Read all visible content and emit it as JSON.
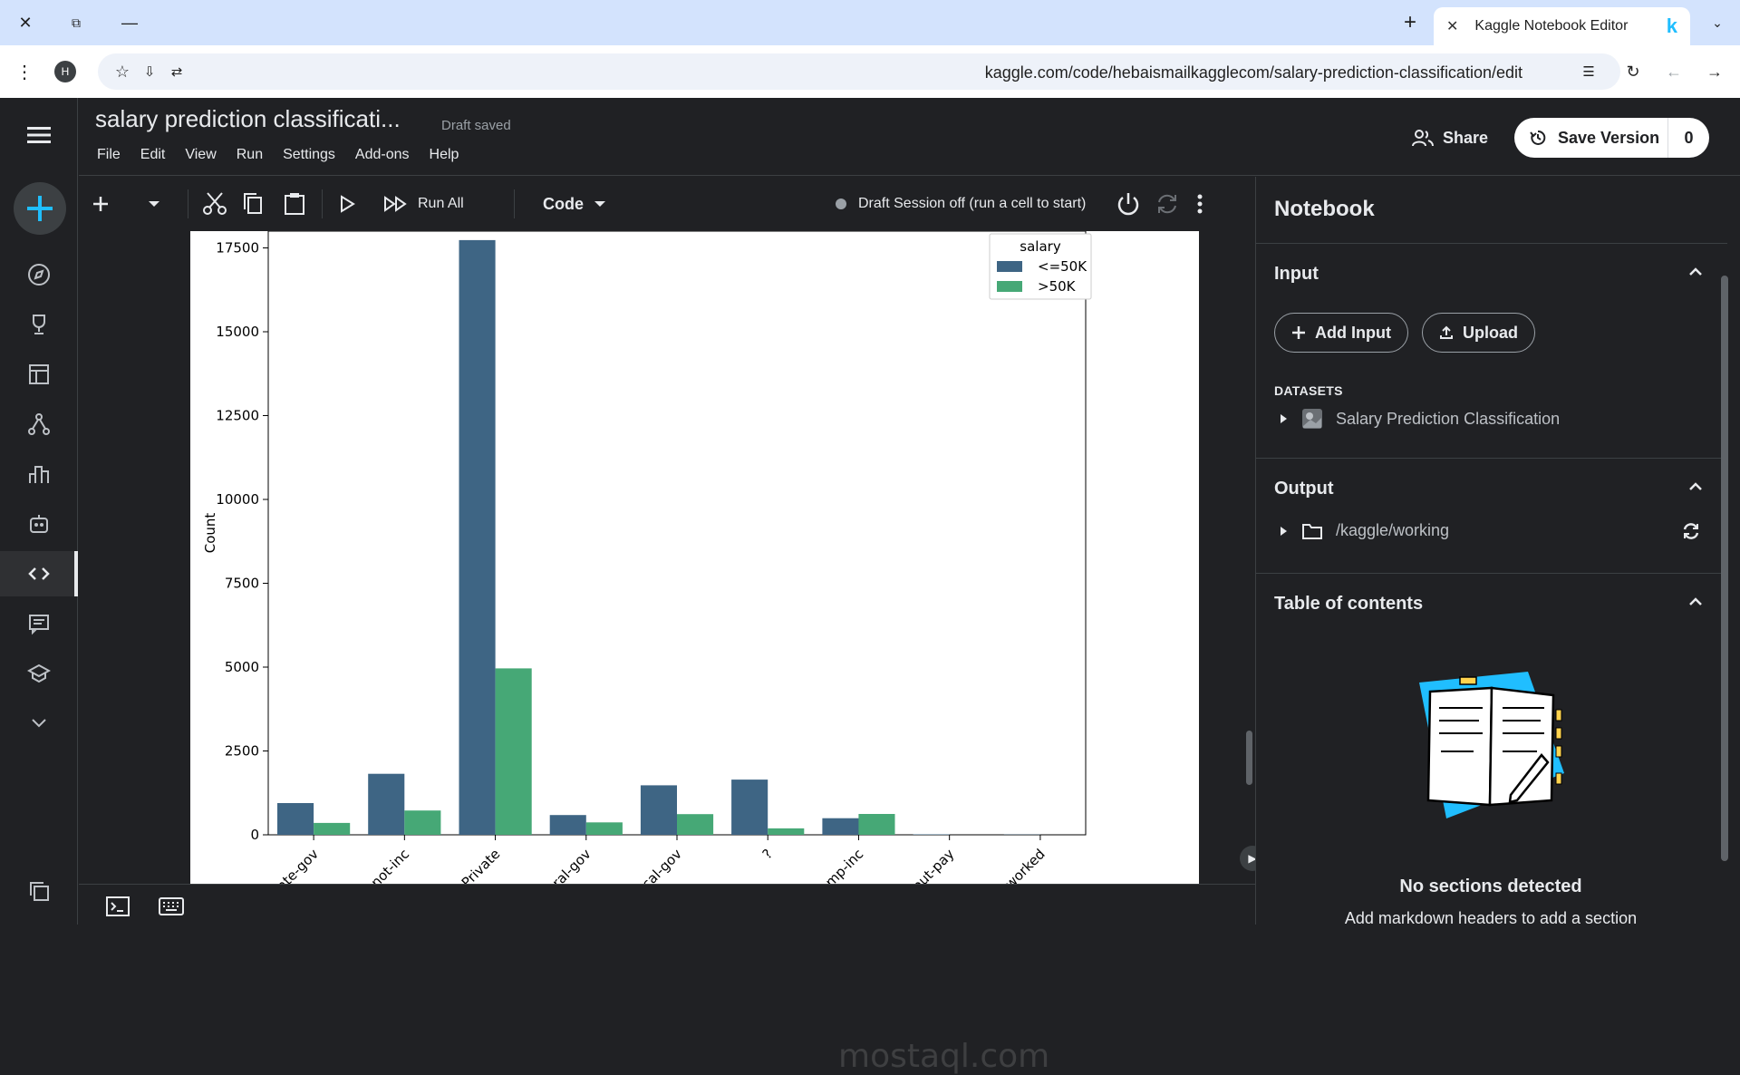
{
  "browser": {
    "tab_title": "Kaggle Notebook Editor",
    "url": "kaggle.com/code/hebaismailkagglecom/salary-prediction-classification/edit",
    "profile_initial": "H"
  },
  "header": {
    "title": "salary prediction classificati...",
    "draft_status": "Draft saved",
    "menu": [
      "File",
      "Edit",
      "View",
      "Run",
      "Settings",
      "Add-ons",
      "Help"
    ],
    "share_label": "Share",
    "save_label": "Save Version",
    "save_count": "0"
  },
  "toolbar": {
    "run_all_label": "Run All",
    "cell_type": "Code",
    "session_status": "Draft Session off (run a cell to start)"
  },
  "right_panel": {
    "title": "Notebook",
    "input_heading": "Input",
    "add_input_label": "Add Input",
    "upload_label": "Upload",
    "datasets_label": "DATASETS",
    "dataset_name": "Salary Prediction Classification",
    "output_heading": "Output",
    "output_path": "/kaggle/working",
    "toc_heading": "Table of contents",
    "toc_empty_title": "No sections detected",
    "toc_empty_sub": "Add markdown headers to add a section"
  },
  "watermark": "mostaql.com",
  "colors": {
    "le50k": "#3e6584",
    "gt50k": "#46a876",
    "accent": "#20beff"
  },
  "chart_data": {
    "type": "bar",
    "ylabel": "Count",
    "xlabel": "",
    "ylim": [
      0,
      18000
    ],
    "yticks": [
      0,
      2500,
      5000,
      7500,
      10000,
      12500,
      15000,
      17500
    ],
    "categories": [
      "State-gov",
      "Self-emp-not-inc",
      "Private",
      "Federal-gov",
      "Local-gov",
      "?",
      "Self-emp-inc",
      "Without-pay",
      "Never-worked"
    ],
    "visible_tick_labels": [
      "State-gov",
      "p-not-inc",
      "Private",
      "ederal-gov",
      "ocal-gov",
      "?",
      "f-emp-inc",
      "thout-pay",
      "r-worked"
    ],
    "legend_title": "salary",
    "legend_position": "top-right",
    "series": [
      {
        "name": "<=50K",
        "values": [
          945,
          1820,
          17733,
          589,
          1476,
          1645,
          494,
          14,
          7
        ]
      },
      {
        "name": ">50K",
        "values": [
          353,
          724,
          4963,
          371,
          617,
          191,
          622,
          0,
          0
        ]
      }
    ]
  }
}
